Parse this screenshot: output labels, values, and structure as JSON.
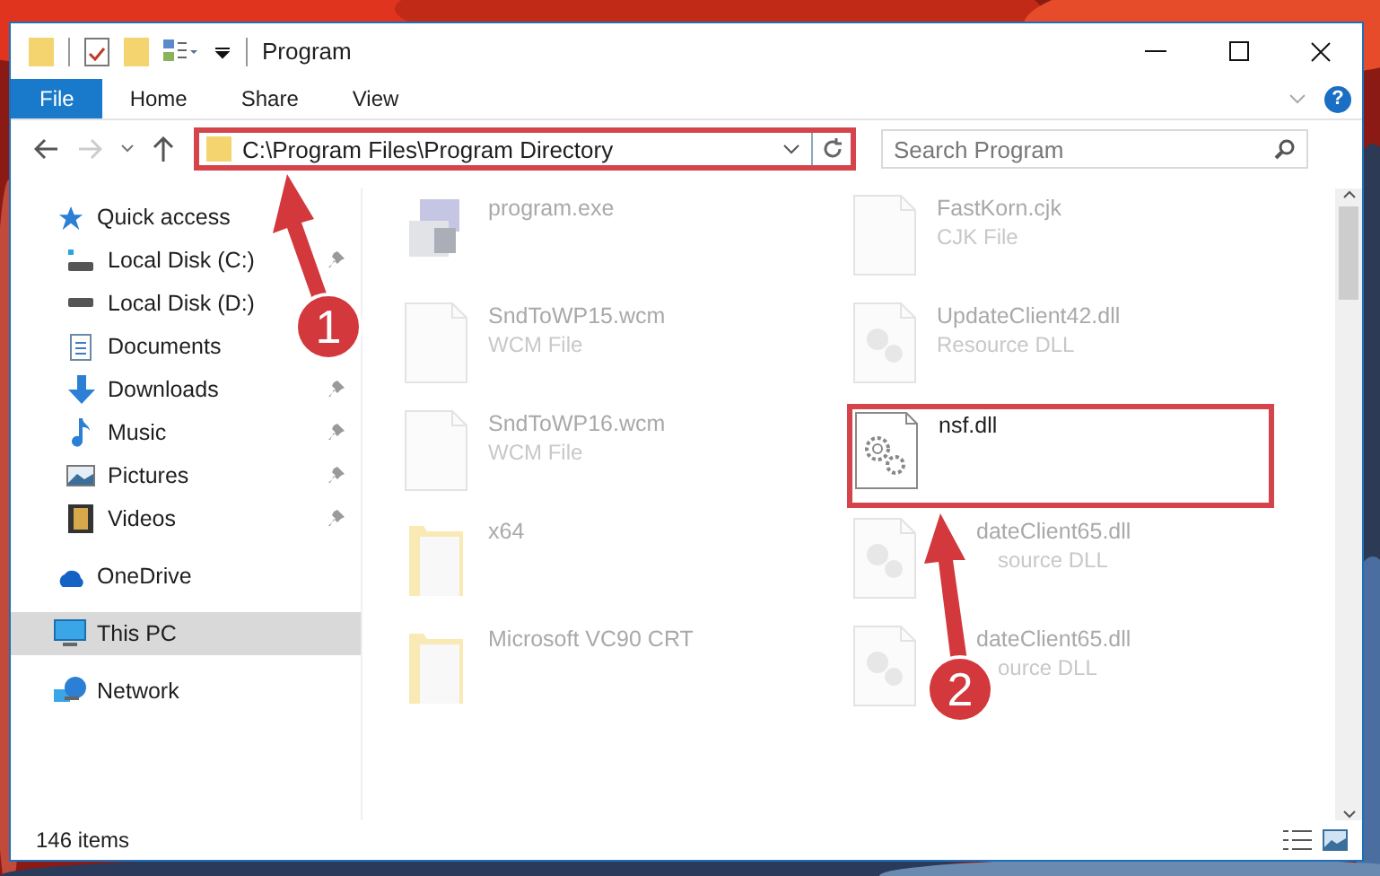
{
  "window": {
    "title": "Program"
  },
  "ribbon": {
    "tabs": [
      {
        "label": "File",
        "selected": true
      },
      {
        "label": "Home",
        "selected": false
      },
      {
        "label": "Share",
        "selected": false
      },
      {
        "label": "View",
        "selected": false
      }
    ],
    "help": "?"
  },
  "address_bar": {
    "path": "C:\\Program Files\\Program Directory",
    "highlighted": true
  },
  "search": {
    "placeholder": "Search Program"
  },
  "sidebar": {
    "items": [
      {
        "label": "Quick access",
        "kind": "star",
        "selected": false,
        "children": [
          {
            "label": "Local Disk (C:)",
            "kind": "drive-c",
            "pinned": true,
            "selected": false
          },
          {
            "label": "Local Disk (D:)",
            "kind": "drive",
            "selected": false
          },
          {
            "label": "Documents",
            "kind": "document",
            "selected": false
          },
          {
            "label": "Downloads",
            "kind": "download",
            "pinned": true,
            "selected": false
          },
          {
            "label": "Music",
            "kind": "music",
            "pinned": true,
            "selected": false
          },
          {
            "label": "Pictures",
            "kind": "pictures",
            "pinned": true,
            "selected": false
          },
          {
            "label": "Videos",
            "kind": "videos",
            "pinned": true,
            "selected": false
          }
        ]
      },
      {
        "label": "OneDrive",
        "kind": "cloud",
        "selected": false
      },
      {
        "label": "This PC",
        "kind": "pc",
        "selected": true
      },
      {
        "label": "Network",
        "kind": "network",
        "selected": false
      }
    ]
  },
  "files": [
    {
      "name": "program.exe",
      "kind": "exe",
      "blurred": true,
      "highlighted": false
    },
    {
      "name": "FastKorn.cjk",
      "type": "CJK File",
      "kind": "blank",
      "blurred": true,
      "highlighted": false
    },
    {
      "name": "SndToWP15.wcm",
      "type": "WCM File",
      "kind": "blank",
      "blurred": true,
      "highlighted": false
    },
    {
      "name": "UpdateClient42.dll",
      "type": "Resource DLL",
      "kind": "dll",
      "blurred": true,
      "highlighted": false
    },
    {
      "name": "SndToWP16.wcm",
      "type": "WCM File",
      "kind": "blank",
      "blurred": true,
      "highlighted": false
    },
    {
      "name": "nsf.dll",
      "kind": "gear",
      "blurred": false,
      "highlighted": true
    },
    {
      "name": "x64",
      "kind": "folder",
      "blurred": true,
      "highlighted": false
    },
    {
      "name": "dateClient65.dll",
      "type": "source DLL",
      "kind": "dll",
      "blurred": true,
      "highlighted": false,
      "covered": true
    },
    {
      "name": "Microsoft VC90 CRT",
      "kind": "folder",
      "blurred": true,
      "highlighted": false
    },
    {
      "name": "dateClient65.dll",
      "type": "ource DLL",
      "kind": "dll",
      "blurred": true,
      "highlighted": false,
      "covered": true
    }
  ],
  "status_bar": {
    "count": "146 items"
  },
  "annotations": [
    {
      "label": "1"
    },
    {
      "label": "2"
    }
  ]
}
